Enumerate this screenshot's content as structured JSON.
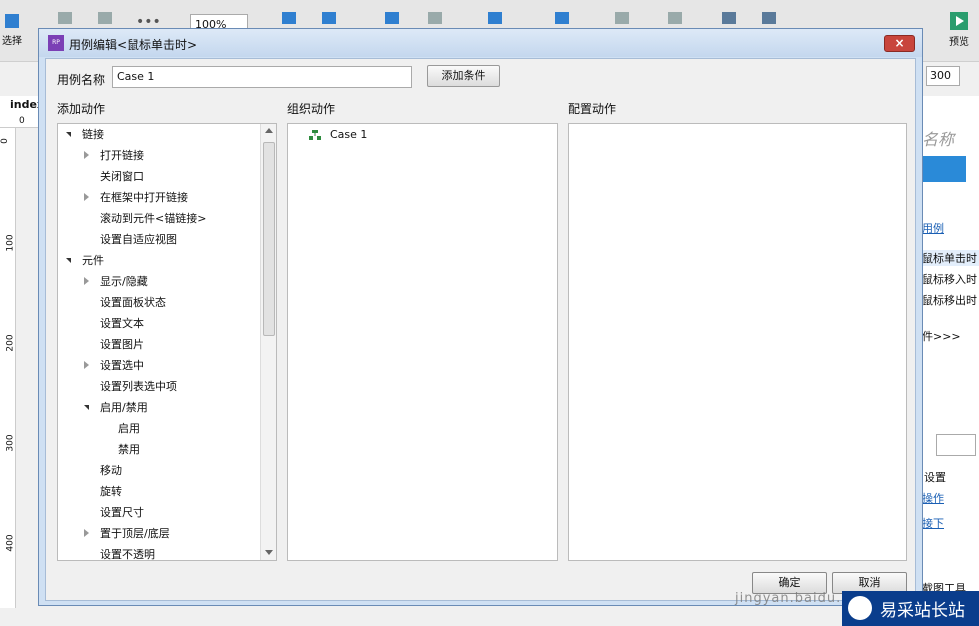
{
  "toolbar": {
    "zoom": "100%",
    "select_label": "选择",
    "preview_label": "预览",
    "width_value": "300"
  },
  "canvas": {
    "tab": "index",
    "ruler_zero": "0",
    "ruler_marks": [
      "0",
      "100",
      "200",
      "300",
      "400"
    ]
  },
  "right_panel": {
    "items": [
      "名称",
      "用例",
      "鼠标单击时",
      "鼠标移入时",
      "鼠标移出时",
      "件>>>",
      "设置",
      "操作",
      "接下",
      "截图工具"
    ]
  },
  "dialog": {
    "title": "用例编辑<鼠标单击时>",
    "close_label": "×",
    "case_name_label": "用例名称",
    "case_name_value": "Case 1",
    "add_condition_label": "添加条件",
    "sections": {
      "add": "添加动作",
      "organize": "组织动作",
      "configure": "配置动作"
    },
    "tree": [
      {
        "label": "链接",
        "level": 0,
        "state": "open"
      },
      {
        "label": "打开链接",
        "level": 1,
        "state": "closed"
      },
      {
        "label": "关闭窗口",
        "level": 1,
        "state": "none"
      },
      {
        "label": "在框架中打开链接",
        "level": 1,
        "state": "closed"
      },
      {
        "label": "滚动到元件<锚链接>",
        "level": 1,
        "state": "none"
      },
      {
        "label": "设置自适应视图",
        "level": 1,
        "state": "none"
      },
      {
        "label": "元件",
        "level": 0,
        "state": "open"
      },
      {
        "label": "显示/隐藏",
        "level": 1,
        "state": "closed"
      },
      {
        "label": "设置面板状态",
        "level": 1,
        "state": "none"
      },
      {
        "label": "设置文本",
        "level": 1,
        "state": "none"
      },
      {
        "label": "设置图片",
        "level": 1,
        "state": "none"
      },
      {
        "label": "设置选中",
        "level": 1,
        "state": "closed"
      },
      {
        "label": "设置列表选中项",
        "level": 1,
        "state": "none"
      },
      {
        "label": "启用/禁用",
        "level": 1,
        "state": "open"
      },
      {
        "label": "启用",
        "level": 2,
        "state": "none"
      },
      {
        "label": "禁用",
        "level": 2,
        "state": "none"
      },
      {
        "label": "移动",
        "level": 1,
        "state": "none"
      },
      {
        "label": "旋转",
        "level": 1,
        "state": "none"
      },
      {
        "label": "设置尺寸",
        "level": 1,
        "state": "none"
      },
      {
        "label": "置于顶层/底层",
        "level": 1,
        "state": "closed"
      },
      {
        "label": "设置不透明",
        "level": 1,
        "state": "none"
      }
    ],
    "organize_items": [
      {
        "label": "Case 1"
      }
    ],
    "ok_label": "确定",
    "cancel_label": "取消"
  },
  "watermark": {
    "brand": "易采站长站",
    "url": "jingyan.baidu.com"
  }
}
